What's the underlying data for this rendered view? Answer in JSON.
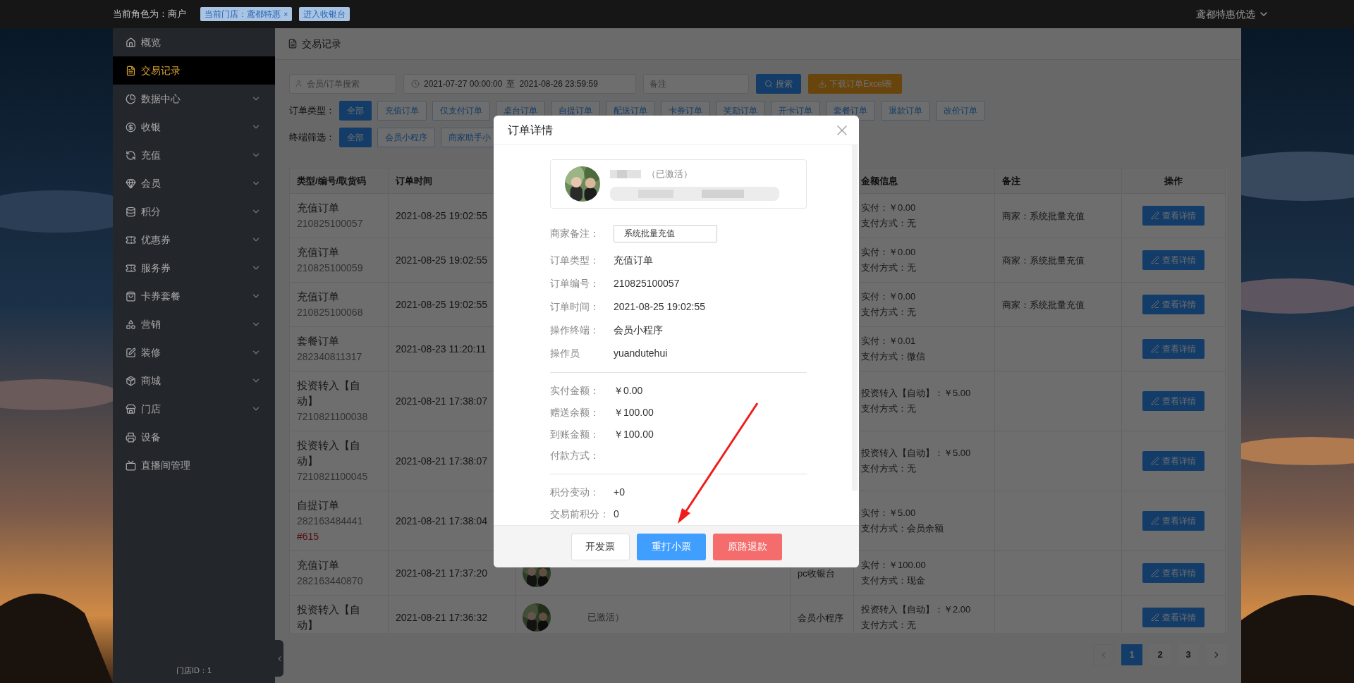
{
  "top_bar": {
    "role": "当前角色为：商户",
    "store_tag": {
      "label": "当前门店：鸢都特惠",
      "close": "×"
    },
    "cashier_link": "进入收银台",
    "account": "鸢都特惠优选"
  },
  "sidebar": {
    "items": [
      {
        "label": "概览",
        "expandable": false,
        "selected": false
      },
      {
        "label": "交易记录",
        "expandable": false,
        "selected": true
      },
      {
        "label": "数据中心",
        "expandable": true,
        "selected": false
      },
      {
        "label": "收银",
        "expandable": true,
        "selected": false
      },
      {
        "label": "充值",
        "expandable": true,
        "selected": false
      },
      {
        "label": "会员",
        "expandable": true,
        "selected": false
      },
      {
        "label": "积分",
        "expandable": true,
        "selected": false
      },
      {
        "label": "优惠券",
        "expandable": true,
        "selected": false
      },
      {
        "label": "服务券",
        "expandable": true,
        "selected": false
      },
      {
        "label": "卡券套餐",
        "expandable": true,
        "selected": false
      },
      {
        "label": "营销",
        "expandable": true,
        "selected": false
      },
      {
        "label": "装修",
        "expandable": true,
        "selected": false
      },
      {
        "label": "商城",
        "expandable": true,
        "selected": false
      },
      {
        "label": "门店",
        "expandable": true,
        "selected": false
      },
      {
        "label": "设备",
        "expandable": false,
        "selected": false
      },
      {
        "label": "直播间管理",
        "expandable": false,
        "selected": false
      }
    ],
    "store_id": "门店ID：1"
  },
  "page_title": "交易记录",
  "filters": {
    "search": {
      "placeholder": "会员/订单搜索"
    },
    "date_start": "2021-07-27 00:00:00",
    "date_separator": "至",
    "date_end": "2021-08-26 23:59:59",
    "remark": {
      "placeholder": "备注"
    },
    "search_button": "搜索",
    "export_button": "下载订单Excel表"
  },
  "order_type": {
    "label": "订单类型：",
    "options": [
      {
        "label": "全部",
        "selected": true
      },
      {
        "label": "充值订单",
        "selected": false
      },
      {
        "label": "仅支付订单",
        "selected": false
      },
      {
        "label": "桌台订单",
        "selected": false
      },
      {
        "label": "自提订单",
        "selected": false
      },
      {
        "label": "配送订单",
        "selected": false
      },
      {
        "label": "卡券订单",
        "selected": false
      },
      {
        "label": "奖励订单",
        "selected": false
      },
      {
        "label": "开卡订单",
        "selected": false
      },
      {
        "label": "套餐订单",
        "selected": false
      },
      {
        "label": "退款订单",
        "selected": false
      },
      {
        "label": "改价订单",
        "selected": false
      }
    ]
  },
  "terminal_filter": {
    "label": "终端筛选：",
    "options": [
      {
        "label": "全部",
        "selected": true
      },
      {
        "label": "会员小程序",
        "selected": false
      },
      {
        "label": "商家助手小",
        "selected": false
      }
    ]
  },
  "table": {
    "columns": [
      "类型/编号/取货码",
      "订单时间",
      "金额信息",
      "备注",
      "操作"
    ],
    "rows": [
      {
        "type": "充值订单",
        "number": "210825100057",
        "time": "2021-08-25 19:02:55",
        "amount": "实付：￥0.00",
        "payment": "支付方式：无",
        "remark": "商家：系统批量充值",
        "action": "查看详情"
      },
      {
        "type": "充值订单",
        "number": "210825100059",
        "time": "2021-08-25 19:02:55",
        "amount": "实付：￥0.00",
        "payment": "支付方式：无",
        "remark": "商家：系统批量充值",
        "action": "查看详情"
      },
      {
        "type": "充值订单",
        "number": "210825100068",
        "time": "2021-08-25 19:02:55",
        "amount": "实付：￥0.00",
        "payment": "支付方式：无",
        "remark": "商家：系统批量充值",
        "action": "查看详情"
      },
      {
        "type": "套餐订单",
        "number": "282340811317",
        "time": "2021-08-23 11:20:11",
        "amount": "实付：￥0.01",
        "payment": "支付方式：微信",
        "action": "查看详情"
      },
      {
        "type": "投资转入【自动】",
        "number": "7210821100038",
        "time": "2021-08-21 17:38:07",
        "amount": "投资转入【自动】：￥5.00",
        "payment": "支付方式：无",
        "action": "查看详情"
      },
      {
        "type": "投资转入【自动】",
        "number": "7210821100045",
        "time": "2021-08-21 17:38:07",
        "amount": "投资转入【自动】：￥5.00",
        "payment": "支付方式：无",
        "action": "查看详情"
      },
      {
        "type": "自提订单",
        "number": "282163484441",
        "pickup_code": "#615",
        "time": "2021-08-21 17:38:04",
        "amount": "实付：￥5.00",
        "payment": "支付方式：会员余额",
        "action": "查看详情"
      },
      {
        "type": "充值订单",
        "number": "282163440870",
        "time": "2021-08-21 17:37:20",
        "terminal": "pc收银台",
        "amount": "实付：￥100.00",
        "payment": "支付方式：现金",
        "action": "查看详情"
      },
      {
        "type": "投资转入【自动】",
        "time": "2021-08-21 17:36:32",
        "member": {
          "kind": "picture",
          "status": "已激活）"
        },
        "terminal": "会员小程序",
        "amount": "投资转入【自动】：￥2.00",
        "payment": "支付方式：无",
        "action": "查看详情"
      }
    ]
  },
  "pagination": {
    "pages": [
      {
        "label": "1",
        "selected": true
      },
      {
        "label": "2",
        "selected": false
      },
      {
        "label": "3",
        "selected": false
      }
    ]
  },
  "modal": {
    "title": "订单详情",
    "member": {
      "status": "（已激活）"
    },
    "remark": {
      "label": "商家备注：",
      "value": "系统批量充值"
    },
    "fields": [
      {
        "label": "订单类型：",
        "value": "充值订单"
      },
      {
        "label": "订单编号：",
        "value": "210825100057"
      },
      {
        "label": "订单时间：",
        "value": "2021-08-25 19:02:55"
      },
      {
        "label": "操作终端：",
        "value": "会员小程序"
      },
      {
        "label": "操作员",
        "value": "yuandutehui"
      }
    ],
    "amounts": [
      {
        "label": "实付金额：",
        "value": "￥0.00"
      },
      {
        "label": "赠送余额：",
        "value": "￥100.00"
      },
      {
        "label": "到账金额：",
        "value": "￥100.00"
      },
      {
        "label": "付款方式："
      }
    ],
    "points": [
      {
        "label": "积分变动：",
        "value": "+0"
      },
      {
        "label": "交易前积分：",
        "value": "0"
      }
    ],
    "buttons": [
      {
        "label": "开发票",
        "kind": "default"
      },
      {
        "label": "重打小票",
        "kind": "primary"
      },
      {
        "label": "原路退款",
        "kind": "danger"
      }
    ]
  }
}
